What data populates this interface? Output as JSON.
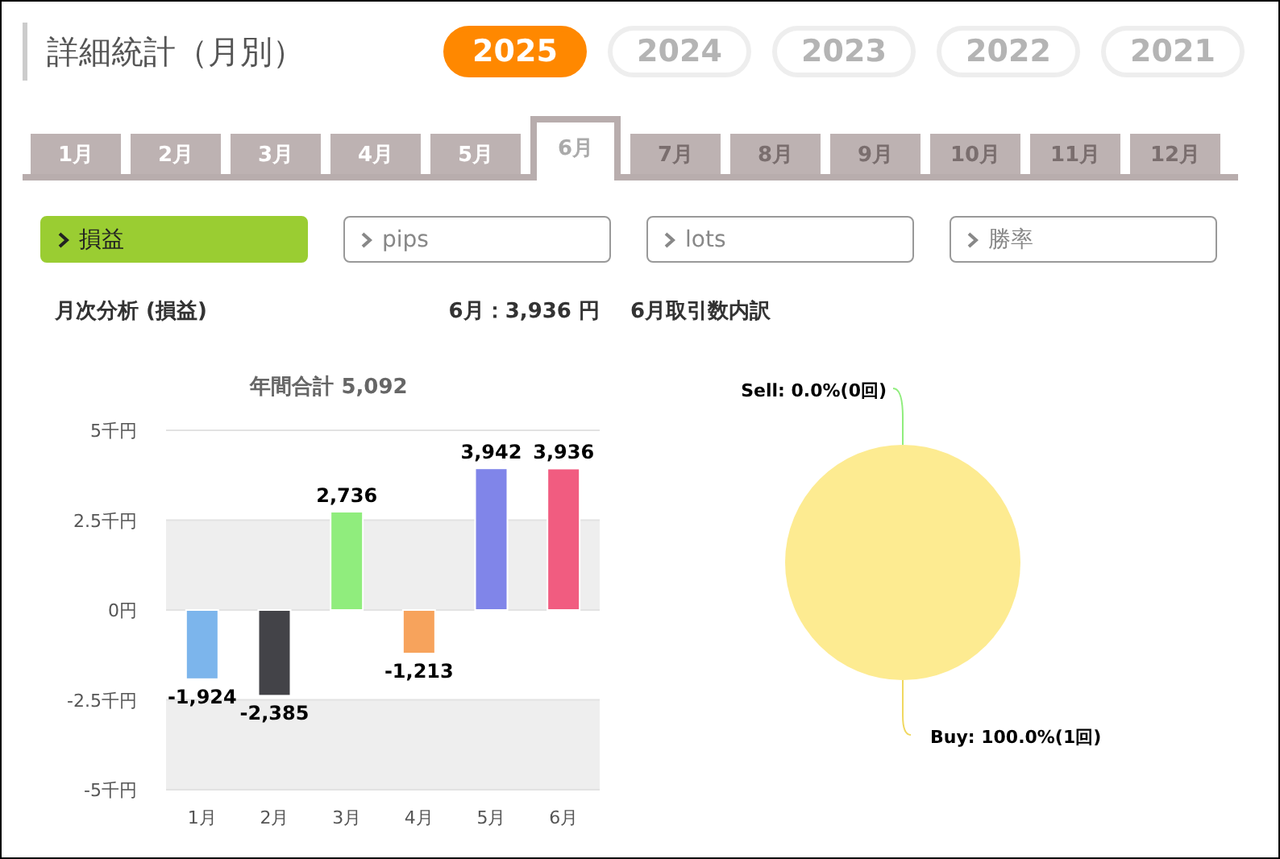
{
  "title": "詳細統計（月別）",
  "years": [
    {
      "label": "2025",
      "selected": true
    },
    {
      "label": "2024",
      "selected": false
    },
    {
      "label": "2023",
      "selected": false
    },
    {
      "label": "2022",
      "selected": false
    },
    {
      "label": "2021",
      "selected": false
    }
  ],
  "months": [
    {
      "label": "1月",
      "selected": false,
      "disabled": false
    },
    {
      "label": "2月",
      "selected": false,
      "disabled": false
    },
    {
      "label": "3月",
      "selected": false,
      "disabled": false
    },
    {
      "label": "4月",
      "selected": false,
      "disabled": false
    },
    {
      "label": "5月",
      "selected": false,
      "disabled": false
    },
    {
      "label": "6月",
      "selected": true,
      "disabled": false
    },
    {
      "label": "7月",
      "selected": false,
      "disabled": true
    },
    {
      "label": "8月",
      "selected": false,
      "disabled": true
    },
    {
      "label": "9月",
      "selected": false,
      "disabled": true
    },
    {
      "label": "10月",
      "selected": false,
      "disabled": true
    },
    {
      "label": "11月",
      "selected": false,
      "disabled": true
    },
    {
      "label": "12月",
      "selected": false,
      "disabled": true
    }
  ],
  "metrics": [
    {
      "label": "損益",
      "selected": true
    },
    {
      "label": "pips",
      "selected": false
    },
    {
      "label": "lots",
      "selected": false
    },
    {
      "label": "勝率",
      "selected": false
    }
  ],
  "monthly": {
    "heading": "月次分析 (損益)",
    "summary": "6月：3,936 円",
    "chart_data": {
      "type": "bar",
      "title": "年間合計 5,092",
      "categories": [
        "1月",
        "2月",
        "3月",
        "4月",
        "5月",
        "6月"
      ],
      "values": [
        -1.924,
        -2.385,
        2.736,
        -1.213,
        3.942,
        3.936
      ],
      "ylim": [
        -5,
        5
      ],
      "grid": true,
      "yticks": [
        {
          "value": -5,
          "label": "-5千円"
        },
        {
          "value": -2.5,
          "label": "-2.5千円"
        },
        {
          "value": 0,
          "label": "0円"
        },
        {
          "value": 2.5,
          "label": "2.5千円"
        },
        {
          "value": 5,
          "label": "5千円"
        }
      ]
    },
    "bar_labels": [
      "-1,924",
      "-2,385",
      "2,736",
      "-1,213",
      "3,942",
      "3,936"
    ]
  },
  "breakdown": {
    "heading": "6月取引数内訳",
    "chart_data": {
      "type": "pie",
      "categories": [
        "Sell: 0.0%(0回)",
        "Buy: 100.0%(1回)"
      ],
      "values": [
        0,
        1
      ]
    }
  }
}
